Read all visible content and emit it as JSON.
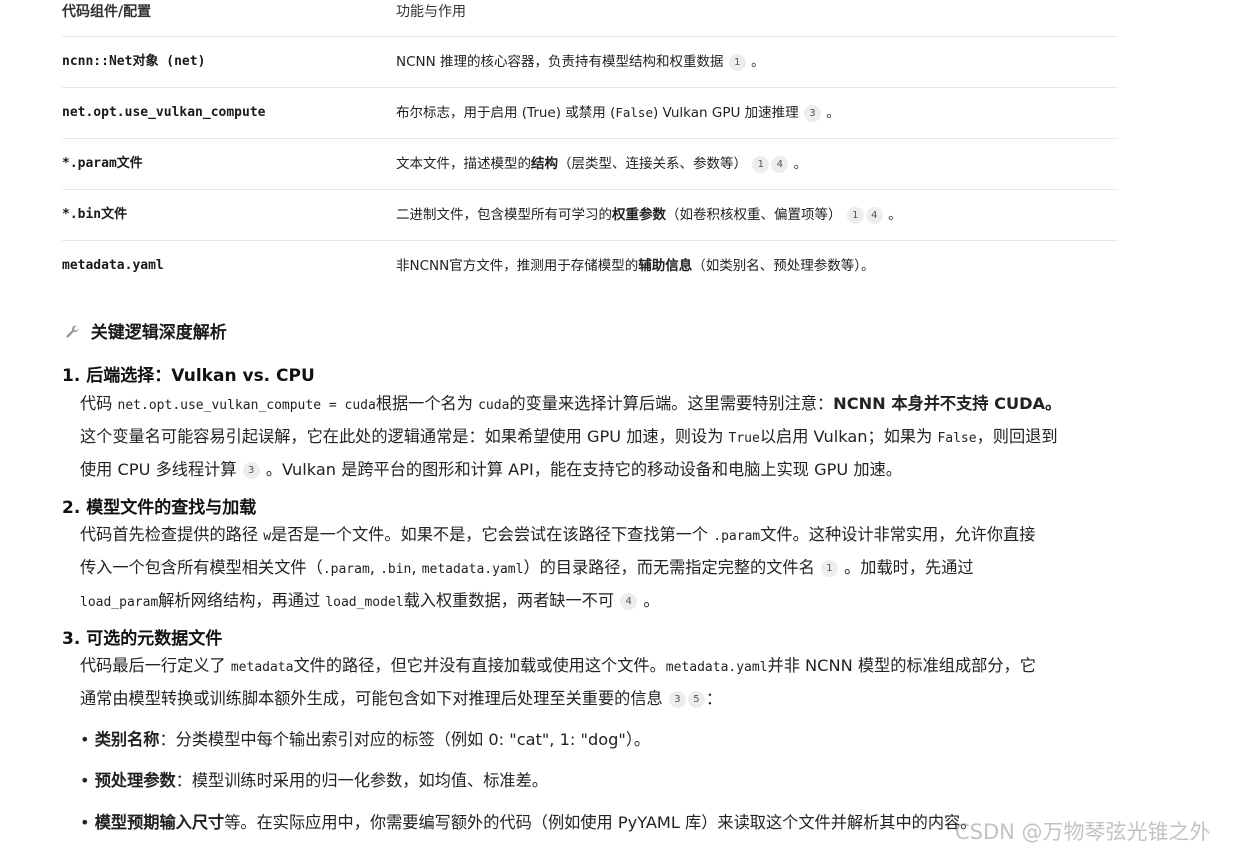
{
  "table": {
    "header": {
      "col1": "代码组件/配置",
      "col2": "功能与作用"
    },
    "rows": [
      {
        "c1": "ncnn::Net对象 (net)",
        "c2_text": "NCNN 推理的核心容器，负责持有模型结构和权重数据",
        "cites": [
          "1"
        ],
        "end": "。"
      },
      {
        "c1": "net.opt.use_vulkan_compute",
        "c2_a": "布尔标志，用于启用 (True) 或禁用 (",
        "c2_code": "False",
        "c2_b": ") Vulkan GPU 加速推理",
        "cites": [
          "3"
        ],
        "end": "。"
      },
      {
        "c1": "*.param文件",
        "c2_a": "文本文件，描述模型的",
        "c2_bold": "结构",
        "c2_b": "（层类型、连接关系、参数等）",
        "cites": [
          "1",
          "4"
        ],
        "end": "。"
      },
      {
        "c1": "*.bin文件",
        "c2_a": "二进制文件，包含模型所有可学习的",
        "c2_bold": "权重参数",
        "c2_b": "（如卷积核权重、偏置项等）",
        "cites": [
          "1",
          "4"
        ],
        "end": "。"
      },
      {
        "c1": "metadata.yaml",
        "c2_a": "非NCNN官方文件，推测用于存储模型的",
        "c2_bold": "辅助信息",
        "c2_b": "（如类别名、预处理参数等）。"
      }
    ]
  },
  "section": {
    "icon": "wrench-icon",
    "title": "关键逻辑深度解析"
  },
  "items": [
    {
      "heading": "1. 后端选择：Vulkan vs. CPU",
      "l1_a": "代码 ",
      "l1_code1": "net.opt.use_vulkan_compute = cuda",
      "l1_b": "根据一个名为 ",
      "l1_code2": "cuda",
      "l1_c": "的变量来选择计算后端。这里需要特别注意：",
      "l1_bold": "NCNN 本身并不支持",
      "l1_d": " CUDA。",
      "l2_a": "这个变量名可能容易引起误解，它在此处的逻辑通常是：如果希望使用 GPU 加速，则设为 ",
      "l2_code1": "True",
      "l2_b": "以启用 Vulkan；如果为 ",
      "l2_code2": "False",
      "l2_c": "，则回退到",
      "l3_a": "使用 CPU 多线程计算",
      "l3_cite": "3",
      "l3_b": "。Vulkan 是跨平台的图形和计算 API，能在支持它的移动设备和电脑上实现 GPU 加速。"
    },
    {
      "heading": "2. 模型文件的查找与加载",
      "l1_a": "代码首先检查提供的路径 ",
      "l1_code1": "w",
      "l1_b": "是否是一个文件。如果不是，它会尝试在该路径下查找第一个 ",
      "l1_code2": ".param",
      "l1_c": "文件。这种设计非常实用，允许你直接",
      "l2_a": "传入一个包含所有模型相关文件（",
      "l2_code1": ".param",
      "l2_sep1": ", ",
      "l2_code2": ".bin",
      "l2_sep2": ", ",
      "l2_code3": "metadata.yaml",
      "l2_b": "）的目录路径，而无需指定完整的文件名",
      "l2_cite": "1",
      "l2_c": "。加载时，先通过",
      "l3_code1": "load_param",
      "l3_a": "解析网络结构，再通过 ",
      "l3_code2": "load_model",
      "l3_b": "载入权重数据，两者缺一不可",
      "l3_cite": "4",
      "l3_c": "。"
    },
    {
      "heading": "3. 可选的元数据文件",
      "l1_a": "代码最后一行定义了 ",
      "l1_code1": "metadata",
      "l1_b": "文件的路径，但它并没有直接加载或使用这个文件。",
      "l1_code2": "metadata.yaml",
      "l1_c": "并非 NCNN 模型的标准组成部分，它",
      "l2_a": "通常由模型转换或训练脚本额外生成，可能包含如下对推理后处理至关重要的信息",
      "l2_cites": [
        "3",
        "5"
      ],
      "l2_b": "："
    }
  ],
  "bullets": [
    {
      "bold": "类别名称",
      "text": "：分类模型中每个输出索引对应的标签（例如 0: \"cat\", 1: \"dog\"）。"
    },
    {
      "bold": "预处理参数",
      "text": "：模型训练时采用的归一化参数，如均值、标准差。"
    },
    {
      "bold": "模型预期输入尺寸",
      "text": "等。在实际应用中，你需要编写额外的代码（例如使用 PyYAML 库）来读取这个文件并解析其中的内容。"
    }
  ],
  "watermark": "CSDN @万物琴弦光锥之外"
}
